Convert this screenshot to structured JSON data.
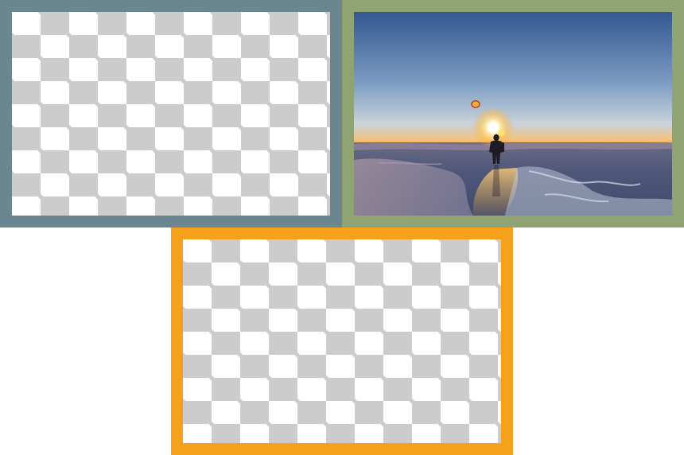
{
  "tiles": [
    {
      "id": "tile-1",
      "frame_color": "#6a8690",
      "content": "transparency-placeholder"
    },
    {
      "id": "tile-2",
      "frame_color": "#8fa472",
      "content": "photo-sunset-ice"
    },
    {
      "id": "tile-3",
      "frame_color": "#f5a11c",
      "content": "transparency-placeholder"
    }
  ],
  "colors": {
    "checker_light": "#ffffff",
    "checker_dark": "#cccccc",
    "sky_top": "#3a5f98",
    "sky_mid": "#b7c9dc",
    "horizon_glow": "#f6a53a",
    "sun": "#fff6c8",
    "ice": "#54587a"
  }
}
